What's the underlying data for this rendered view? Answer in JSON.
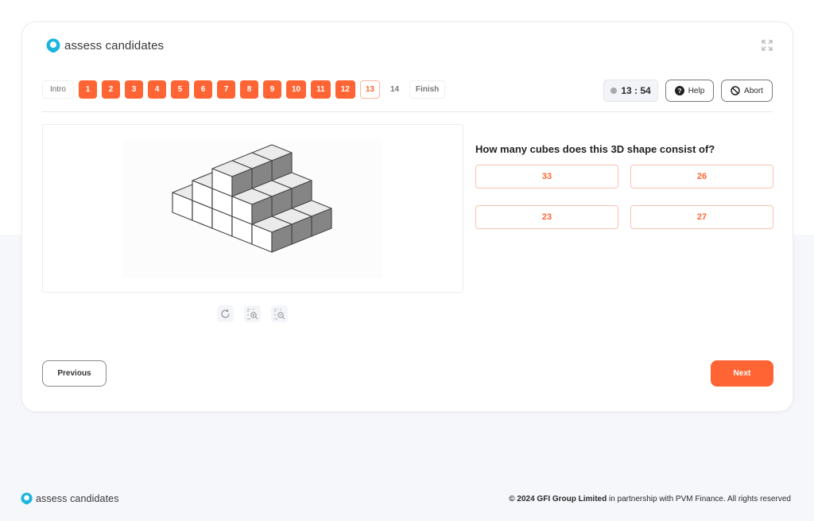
{
  "brand": {
    "name": "assess candidates",
    "color": "#1cb5e0"
  },
  "nav": {
    "intro_label": "Intro",
    "questions": [
      {
        "label": "1",
        "state": "done"
      },
      {
        "label": "2",
        "state": "done"
      },
      {
        "label": "3",
        "state": "done"
      },
      {
        "label": "4",
        "state": "done"
      },
      {
        "label": "5",
        "state": "done"
      },
      {
        "label": "6",
        "state": "done"
      },
      {
        "label": "7",
        "state": "done"
      },
      {
        "label": "8",
        "state": "done"
      },
      {
        "label": "9",
        "state": "done"
      },
      {
        "label": "10",
        "state": "done"
      },
      {
        "label": "11",
        "state": "done"
      },
      {
        "label": "12",
        "state": "done"
      },
      {
        "label": "13",
        "state": "current"
      },
      {
        "label": "14",
        "state": "pending"
      }
    ],
    "finish_label": "Finish"
  },
  "header": {
    "timer": "13 : 54",
    "help_label": "Help",
    "abort_label": "Abort",
    "expand_icon": "expand-icon"
  },
  "question": {
    "text": "How many cubes does this 3D shape consist of?",
    "image_alt": "3D cube stack",
    "options": [
      "33",
      "26",
      "23",
      "27"
    ]
  },
  "image_tools": [
    "rotate-icon",
    "zoom-in-icon",
    "zoom-out-icon"
  ],
  "footer_nav": {
    "previous_label": "Previous",
    "next_label": "Next"
  },
  "footer": {
    "copyright_bold": "© 2024 GFI Group Limited",
    "copyright_rest": " in partnership with PVM Finance. All rights reserved"
  },
  "colors": {
    "accent": "#ff6534",
    "accent_border": "#f8c3b1",
    "background": "#f6f7fb"
  }
}
